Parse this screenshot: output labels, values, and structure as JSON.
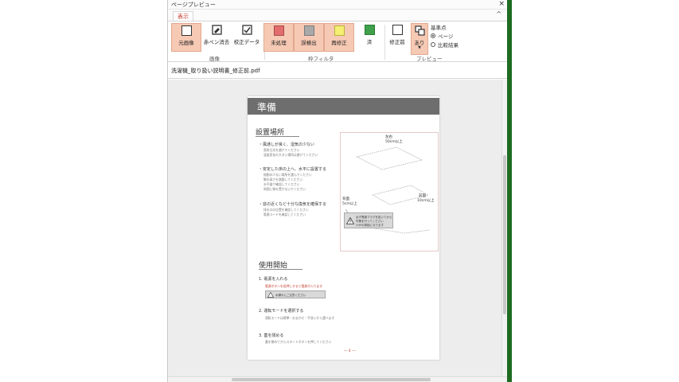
{
  "window": {
    "title": "ページプレビュー",
    "close_glyph": "×"
  },
  "tabs": {
    "view_label": "表示",
    "collapse_glyph": "^"
  },
  "ribbon": {
    "image_group": {
      "label": "画像",
      "buttons": [
        {
          "label": "元画像",
          "icon": "blank-page-icon",
          "selected": true
        },
        {
          "label": "赤ペン消去",
          "icon": "eraser-page-icon",
          "selected": false
        },
        {
          "label": "校正データ",
          "icon": "checked-page-icon",
          "selected": false
        }
      ]
    },
    "filter_group": {
      "label": "枠フィルタ",
      "buttons": [
        {
          "label": "未処理",
          "icon": "red-square-icon",
          "color": "#e26d6d",
          "selected": true
        },
        {
          "label": "誤検出",
          "icon": "gray-square-icon",
          "color": "#a9a9a9",
          "selected": true
        },
        {
          "label": "再修正",
          "icon": "yellow-square-icon",
          "color": "#f4ef72",
          "selected": true
        },
        {
          "label": "済",
          "icon": "green-square-icon",
          "color": "#3fa14b",
          "selected": false
        }
      ]
    },
    "preview_group": {
      "label": "プレビュー",
      "buttons": [
        {
          "label": "修正前",
          "icon": "blank-page-icon",
          "selected": false
        },
        {
          "label": "あり",
          "icon": "layers-icon",
          "selected": true
        }
      ],
      "radio_title": "基準点",
      "radios": [
        {
          "label": "ページ",
          "checked": true
        },
        {
          "label": "比較結果",
          "checked": false
        }
      ]
    }
  },
  "file": {
    "name": "洗濯機_取り扱い説明書_修正前.pdf"
  },
  "page": {
    "header_title": "準備",
    "section1_title": "設置場所",
    "bullets1": [
      "・風通しが良く、湿気の少ない",
      "・安定した床の上へ、水平に設置する",
      "・窓の近くなど十分な換気を確保する"
    ],
    "subtexts1": [
      "直射日光を避けてください",
      "温度変化の大きい場所は避けてください",
      "振動の少ない場所を選んでください",
      "脚の高さを調整してください",
      "水平器で確認してください",
      "周囲に物を置かないでください",
      "排水口の位置を確認してください",
      "電源コードを確認してください"
    ],
    "fig_notes": [
      "左右",
      "50cm以上",
      "背面",
      "5cm以上",
      "前面",
      "10cm以上"
    ],
    "warn_text": [
      "必ず電源プラグを抜いてから",
      "作業を行ってください",
      "けがの原因になります"
    ],
    "section2_title": "使用開始",
    "steps": [
      "1. 電源を入れる",
      "2. 運転モードを選択する",
      "3. 蓋を閉める"
    ],
    "red_note": "電源ボタンを長押しすると電源が入ります",
    "warn2_text": "水漏れにご注意ください",
    "step_subtexts": [
      "運転モードは標準・おまかせ・手洗いから選べます",
      "蓋を閉めてからスタートボタンを押してください"
    ],
    "page_number": "― 4 ―"
  }
}
